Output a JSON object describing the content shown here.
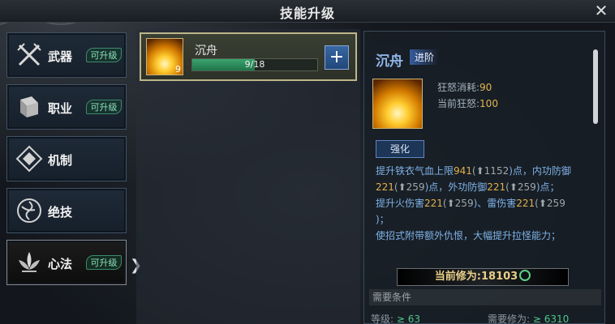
{
  "window": {
    "title": "技能升级"
  },
  "nav": {
    "items": [
      {
        "label": "武器",
        "badge": "可升级",
        "icon": "crossed-swords-icon"
      },
      {
        "label": "职业",
        "badge": "可升级",
        "icon": "book-icon"
      },
      {
        "label": "机制",
        "badge": "",
        "icon": "diamond-emblem-icon"
      },
      {
        "label": "绝技",
        "badge": "",
        "icon": "triskelion-icon"
      },
      {
        "label": "心法",
        "badge": "可升级",
        "icon": "lotus-icon"
      }
    ],
    "active_index": 4
  },
  "skill_list": [
    {
      "name": "沉舟",
      "level": "9",
      "progress_text": "9/18",
      "progress": 0.5
    }
  ],
  "detail": {
    "name": "沉舟",
    "tag": "进阶",
    "rage_cost_label": "狂怒消耗:",
    "rage_cost": "90",
    "current_rage_label": "当前狂怒:",
    "current_rage": "100",
    "enhance_label": "强化",
    "desc": {
      "l1a": "提升铁衣气血上限",
      "l1b": "941",
      "l1c": "(",
      "l1d": "1152",
      "l1e": ")点，内功防御",
      "l2a": "221",
      "l2b": "(",
      "l2c": "259",
      "l2d": ")点，外功防御",
      "l2e": "221",
      "l2f": "(",
      "l2g": "259",
      "l2h": ")点；",
      "l3a": "提升火伤害",
      "l3b": "221",
      "l3c": "(",
      "l3d": "259",
      "l3e": ")、雷伤害",
      "l3f": "221",
      "l3g": "(",
      "l3h": "259",
      "l4": ")；",
      "l5": "使招式附带额外仇恨，大幅提升拉怪能力；"
    },
    "cultivation_label": "当前修为:",
    "cultivation_value": "18103",
    "requirements_title": "需要条件",
    "req_level_label": "等级:",
    "req_level_value": "≥ 63",
    "req_cult_label": "需要修为:",
    "req_cult_value": "≥ 6310"
  },
  "colors": {
    "accent_green": "#4fc58a",
    "gold": "#e0b04e",
    "blue_text": "#7fb2e8"
  }
}
